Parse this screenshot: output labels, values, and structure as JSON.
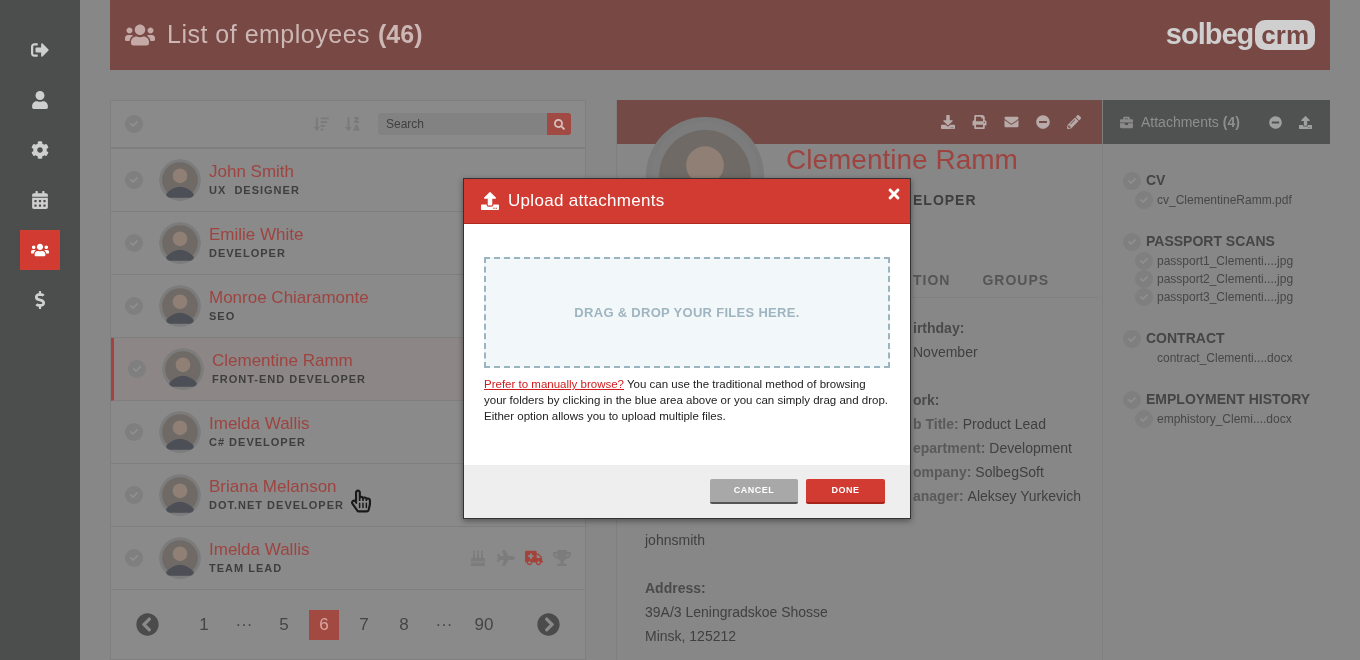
{
  "sidebar": {
    "items": [
      {
        "selected": false
      },
      {
        "selected": false
      },
      {
        "selected": false
      },
      {
        "selected": false
      },
      {
        "selected": true
      },
      {
        "selected": false
      }
    ]
  },
  "header": {
    "title": "List of employees",
    "count": "(46)",
    "logo": {
      "part_1": "solbeg",
      "part_2": "crm"
    }
  },
  "list": {
    "search": {
      "placeholder": "Search"
    },
    "rows": [
      {
        "name": "John Smith",
        "role": "UX  DESIGNER",
        "selected": false
      },
      {
        "name": "Emilie White",
        "role": "DEVELOPER",
        "selected": false
      },
      {
        "name": "Monroe Chiaramonte",
        "role": "SEO",
        "selected": false
      },
      {
        "name": "Clementine Ramm",
        "role": "FRONT-END DEVELOPER",
        "selected": true
      },
      {
        "name": "Imelda Wallis",
        "role": "C# DEVELOPER",
        "selected": false
      },
      {
        "name": "Briana Melanson",
        "role": "DOT.NET DEVELOPER",
        "selected": false
      },
      {
        "name": "Imelda Wallis",
        "role": "TEAM LEAD",
        "selected": false,
        "events": [
          {
            "active": false
          },
          {
            "active": false
          },
          {
            "active": true
          },
          {
            "active": false
          }
        ]
      }
    ],
    "pagination": [
      {
        "label": "1",
        "selected": false
      },
      {
        "label": "···",
        "selected": false
      },
      {
        "label": "5",
        "selected": false
      },
      {
        "label": "6",
        "selected": true
      },
      {
        "label": "7",
        "selected": false
      },
      {
        "label": "8",
        "selected": false
      },
      {
        "label": "···",
        "selected": false
      },
      {
        "label": "90",
        "selected": false
      }
    ]
  },
  "detail": {
    "name": "Clementine Ramm",
    "role": "ELOPER",
    "tabs": [
      {
        "label": "TION",
        "selected": false
      },
      {
        "label": "GROUPS",
        "selected": false
      }
    ],
    "birthday": {
      "label": "irthday:",
      "value": "November"
    },
    "work": {
      "title": "ork:",
      "fields": [
        {
          "label": "b Title:",
          "value": "Product Lead"
        },
        {
          "label": "epartment:",
          "value": "Development"
        },
        {
          "label": "ompany:",
          "value": "SolbegSoft"
        },
        {
          "label": "anager:",
          "value": "Aleksey Yurkevich"
        }
      ]
    },
    "contact_value": "johnsmith",
    "address": {
      "label": "Address:",
      "lines": [
        "39A/3 Leningradskoe Shosse",
        "Minsk, 125212"
      ]
    }
  },
  "attachments": {
    "title": "Attachments",
    "count": "(4)",
    "groups": [
      {
        "title": "CV",
        "files": [
          {
            "name": "cv_ClementineRamm.pdf",
            "kind": "checkbox"
          }
        ]
      },
      {
        "title": "PASSPORT SCANS",
        "files": [
          {
            "name": "passport1_Clementi....jpg",
            "kind": "checkbox"
          },
          {
            "name": "passport2_Clementi....jpg",
            "kind": "checkbox"
          },
          {
            "name": "passport3_Clementi....jpg",
            "kind": "checkbox"
          }
        ]
      },
      {
        "title": "CONTRACT",
        "files": [
          {
            "name": "contract_Clementi....docx",
            "kind": "plain"
          }
        ]
      },
      {
        "title": "EMPLOYMENT HISTORY",
        "files": [
          {
            "name": "emphistory_Clemi....docx",
            "kind": "checkbox"
          }
        ]
      }
    ]
  },
  "dialog": {
    "title": "Upload attachments",
    "dropzone": "DRAG & DROP YOUR FILES HERE.",
    "link": "Prefer to manually browse?",
    "text": "You can use the traditional method of browsing your folders by clicking in the blue area above or you can simply drag and drop. Either option allows you to upload multiple files.",
    "buttons": [
      {
        "label": "CANCEL",
        "kind": "secondary"
      },
      {
        "label": "DONE",
        "kind": "primary"
      }
    ]
  }
}
